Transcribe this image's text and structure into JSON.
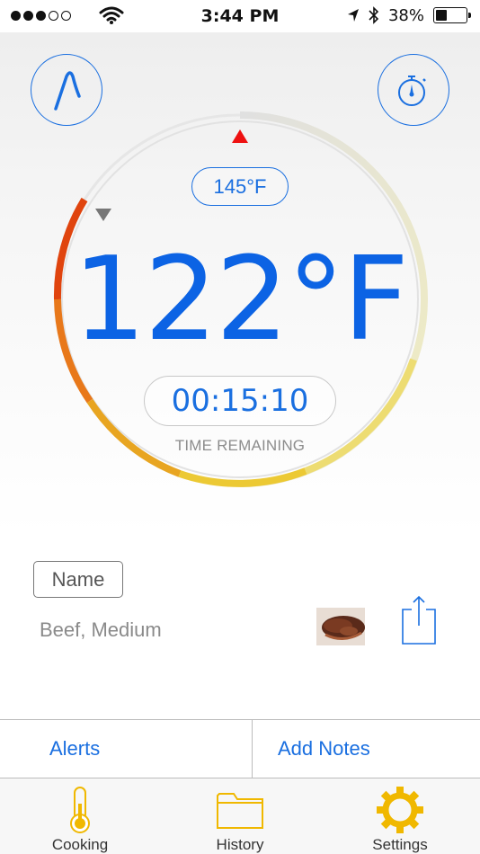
{
  "status_bar": {
    "time": "3:44 PM",
    "battery_percent": "38%",
    "battery_level": 0.38,
    "signal_bars_filled": 3,
    "signal_bars_total": 5
  },
  "top_buttons": {
    "probe_icon": "thermometer-probe-icon",
    "timer_icon": "stopwatch-icon"
  },
  "dial": {
    "target_temp": "145°F",
    "current_temp": "122°F",
    "time_remaining": "00:15:10",
    "time_remaining_label": "TIME REMAINING",
    "colors": {
      "accent_blue": "#1a6fe0",
      "target_marker": "#ee1111",
      "current_marker": "#777777"
    }
  },
  "info": {
    "name_label": "Name",
    "meat_description": "Beef, Medium",
    "share_icon": "share-icon"
  },
  "actions": {
    "alerts_label": "Alerts",
    "add_notes_label": "Add Notes"
  },
  "tabs": [
    {
      "label": "Cooking",
      "icon": "thermometer-icon"
    },
    {
      "label": "History",
      "icon": "folder-icon"
    },
    {
      "label": "Settings",
      "icon": "gear-icon"
    }
  ]
}
